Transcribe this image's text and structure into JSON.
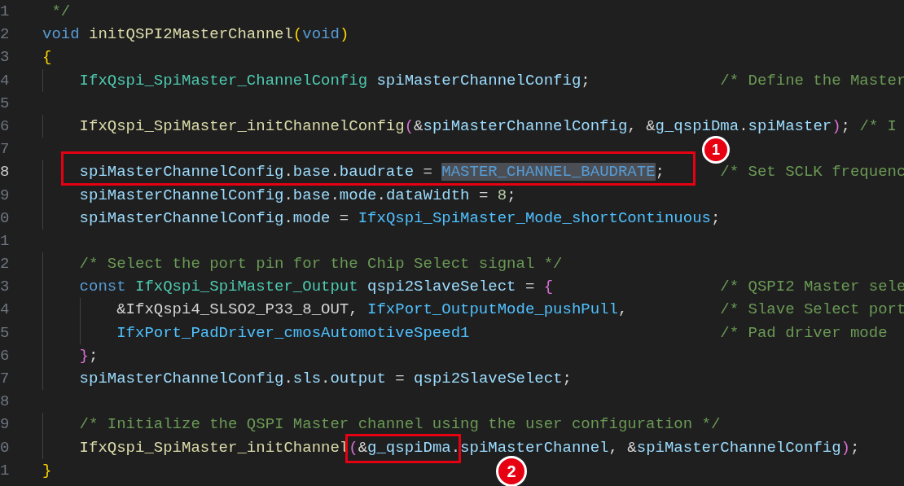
{
  "editor": {
    "lines": [
      {
        "number": "1",
        "current": false,
        "tokens": [
          {
            "text": " */",
            "kind": "comment"
          }
        ]
      },
      {
        "number": "2",
        "current": false,
        "tokens": [
          {
            "text": "void ",
            "kind": "keyword"
          },
          {
            "text": "initQSPI2MasterChannel",
            "kind": "function"
          },
          {
            "text": "(",
            "kind": "bracket1"
          },
          {
            "text": "void",
            "kind": "keyword"
          },
          {
            "text": ")",
            "kind": "bracket1"
          }
        ]
      },
      {
        "number": "3",
        "current": false,
        "tokens": [
          {
            "text": "{",
            "kind": "bracket1"
          }
        ]
      },
      {
        "number": "4",
        "current": false,
        "tokens": [
          {
            "text": "    IfxQspi_SpiMaster_ChannelConfig ",
            "kind": "type"
          },
          {
            "text": "spiMasterChannelConfig",
            "kind": "variable"
          },
          {
            "text": ";",
            "kind": "plain"
          }
        ],
        "comment": "/* Define the Master"
      },
      {
        "number": "5",
        "current": false
      },
      {
        "number": "6",
        "current": false,
        "tokens": [
          {
            "text": "    IfxQspi_SpiMaster_initChannelConfig",
            "kind": "function"
          },
          {
            "text": "(",
            "kind": "bracket2"
          },
          {
            "text": "&",
            "kind": "plain"
          },
          {
            "text": "spiMasterChannelConfig",
            "kind": "variable"
          },
          {
            "text": ", &",
            "kind": "plain"
          },
          {
            "text": "g_qspiDma",
            "kind": "variable"
          },
          {
            "text": ".",
            "kind": "plain"
          },
          {
            "text": "spiMaster",
            "kind": "variable"
          },
          {
            "text": ")",
            "kind": "bracket2"
          },
          {
            "text": ";",
            "kind": "plain"
          }
        ],
        "comment": "/* I"
      },
      {
        "number": "7",
        "current": false
      },
      {
        "number": "8",
        "current": true,
        "tokens": [
          {
            "text": "    spiMasterChannelConfig",
            "kind": "variable"
          },
          {
            "text": ".",
            "kind": "plain"
          },
          {
            "text": "base",
            "kind": "variable"
          },
          {
            "text": ".",
            "kind": "plain"
          },
          {
            "text": "baudrate",
            "kind": "variable"
          },
          {
            "text": " = ",
            "kind": "plain"
          },
          {
            "text": "MASTER_CHANNEL_BAUDRATE",
            "kind": "macro",
            "highlighted": true
          },
          {
            "text": ";",
            "kind": "plain"
          }
        ],
        "comment": "/* Set SCLK frequenc"
      },
      {
        "number": "9",
        "current": false,
        "tokens": [
          {
            "text": "    spiMasterChannelConfig",
            "kind": "variable"
          },
          {
            "text": ".",
            "kind": "plain"
          },
          {
            "text": "base",
            "kind": "variable"
          },
          {
            "text": ".",
            "kind": "plain"
          },
          {
            "text": "mode",
            "kind": "variable"
          },
          {
            "text": ".",
            "kind": "plain"
          },
          {
            "text": "dataWidth",
            "kind": "variable"
          },
          {
            "text": " = ",
            "kind": "plain"
          },
          {
            "text": "8",
            "kind": "number"
          },
          {
            "text": ";",
            "kind": "plain"
          }
        ]
      },
      {
        "number": "0",
        "current": false,
        "tokens": [
          {
            "text": "    spiMasterChannelConfig",
            "kind": "variable"
          },
          {
            "text": ".",
            "kind": "plain"
          },
          {
            "text": "mode",
            "kind": "variable"
          },
          {
            "text": " = ",
            "kind": "plain"
          },
          {
            "text": "IfxQspi_SpiMaster_Mode_shortContinuous",
            "kind": "constant"
          },
          {
            "text": ";",
            "kind": "plain"
          }
        ]
      },
      {
        "number": "1",
        "current": false
      },
      {
        "number": "2",
        "current": false,
        "tokens": [
          {
            "text": "    /* Select the port pin for the Chip Select signal */",
            "kind": "comment"
          }
        ]
      },
      {
        "number": "3",
        "current": false,
        "tokens": [
          {
            "text": "    const ",
            "kind": "keyword"
          },
          {
            "text": "IfxQspi_SpiMaster_Output ",
            "kind": "type"
          },
          {
            "text": "qspi2SlaveSelect",
            "kind": "variable"
          },
          {
            "text": " = ",
            "kind": "plain"
          },
          {
            "text": "{",
            "kind": "bracket2"
          }
        ],
        "comment": "/* QSPI2 Master sele"
      },
      {
        "number": "4",
        "current": false,
        "tokens": [
          {
            "text": "        &IfxQspi4_SLSO2_P33_8_OUT, ",
            "kind": "plain"
          },
          {
            "text": "IfxPort_OutputMode_pushPull",
            "kind": "constant"
          },
          {
            "text": ",",
            "kind": "plain"
          }
        ],
        "comment": "/* Slave Select port"
      },
      {
        "number": "5",
        "current": false,
        "tokens": [
          {
            "text": "        IfxPort_PadDriver_cmosAutomotiveSpeed1",
            "kind": "constant"
          }
        ],
        "comment": "/* Pad driver mode"
      },
      {
        "number": "6",
        "current": false,
        "tokens": [
          {
            "text": "    }",
            "kind": "bracket2"
          },
          {
            "text": ";",
            "kind": "plain"
          }
        ]
      },
      {
        "number": "7",
        "current": false,
        "tokens": [
          {
            "text": "    spiMasterChannelConfig",
            "kind": "variable"
          },
          {
            "text": ".",
            "kind": "plain"
          },
          {
            "text": "sls",
            "kind": "variable"
          },
          {
            "text": ".",
            "kind": "plain"
          },
          {
            "text": "output",
            "kind": "variable"
          },
          {
            "text": " = ",
            "kind": "plain"
          },
          {
            "text": "qspi2SlaveSelect",
            "kind": "variable"
          },
          {
            "text": ";",
            "kind": "plain"
          }
        ]
      },
      {
        "number": "8",
        "current": false
      },
      {
        "number": "9",
        "current": false,
        "tokens": [
          {
            "text": "    /* Initialize the QSPI Master channel using the user configuration */",
            "kind": "comment"
          }
        ]
      },
      {
        "number": "0",
        "current": false,
        "tokens": [
          {
            "text": "    IfxQspi_SpiMaster_initChannel",
            "kind": "function"
          },
          {
            "text": "(",
            "kind": "bracket2"
          },
          {
            "text": "&",
            "kind": "plain"
          },
          {
            "text": "g_qspiDma",
            "kind": "variable"
          },
          {
            "text": ".",
            "kind": "plain"
          },
          {
            "text": "spiMasterChannel",
            "kind": "variable"
          },
          {
            "text": ", &",
            "kind": "plain"
          },
          {
            "text": "spiMasterChannelConfig",
            "kind": "variable"
          },
          {
            "text": ")",
            "kind": "bracket2"
          },
          {
            "text": ";",
            "kind": "plain"
          }
        ]
      },
      {
        "number": "1",
        "current": false,
        "tokens": [
          {
            "text": "}",
            "kind": "bracket1"
          }
        ]
      }
    ]
  },
  "annotations": [
    {
      "label": "1"
    },
    {
      "label": "2"
    }
  ]
}
